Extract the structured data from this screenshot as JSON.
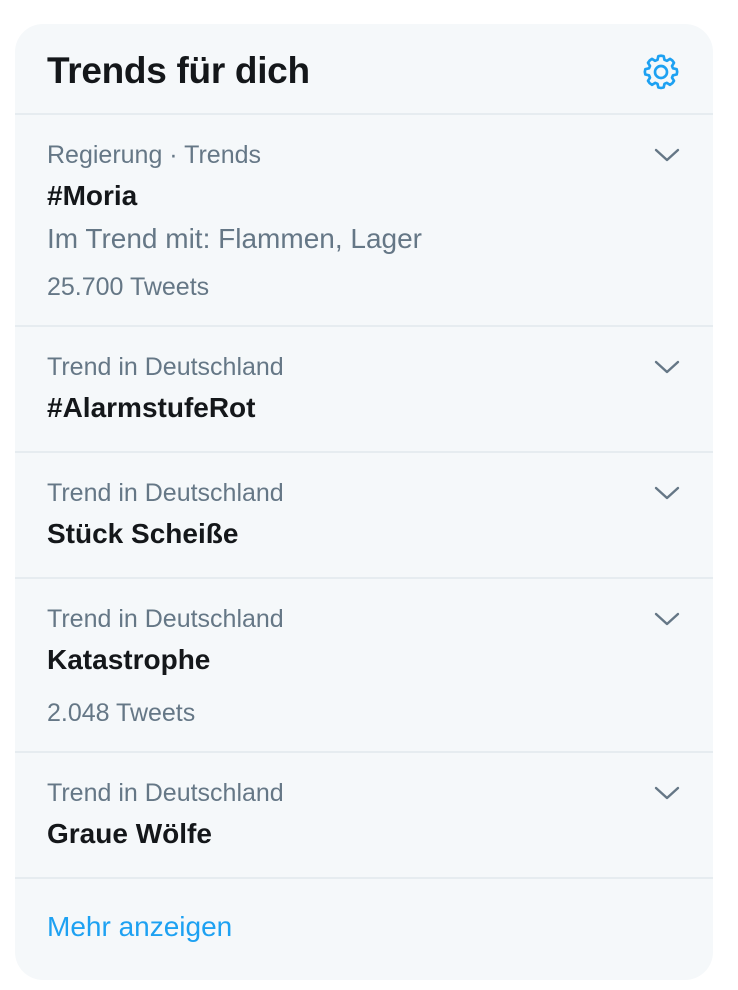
{
  "header": {
    "title": "Trends für dich",
    "settings_icon": "gear-icon"
  },
  "trends": [
    {
      "context": "Regierung · Trends",
      "name": "#Moria",
      "related": "Im Trend mit: Flammen, Lager",
      "count": "25.700 Tweets"
    },
    {
      "context": "Trend in Deutschland",
      "name": "#AlarmstufeRot"
    },
    {
      "context": "Trend in Deutschland",
      "name": "Stück Scheiße"
    },
    {
      "context": "Trend in Deutschland",
      "name": "Katastrophe",
      "count": "2.048 Tweets"
    },
    {
      "context": "Trend in Deutschland",
      "name": "Graue Wölfe"
    }
  ],
  "show_more_label": "Mehr anzeigen",
  "colors": {
    "accent": "#1da1f2",
    "background": "#f5f8fa",
    "primary_text": "#14171a",
    "secondary_text": "#657786",
    "divider": "#e6ecf0"
  }
}
